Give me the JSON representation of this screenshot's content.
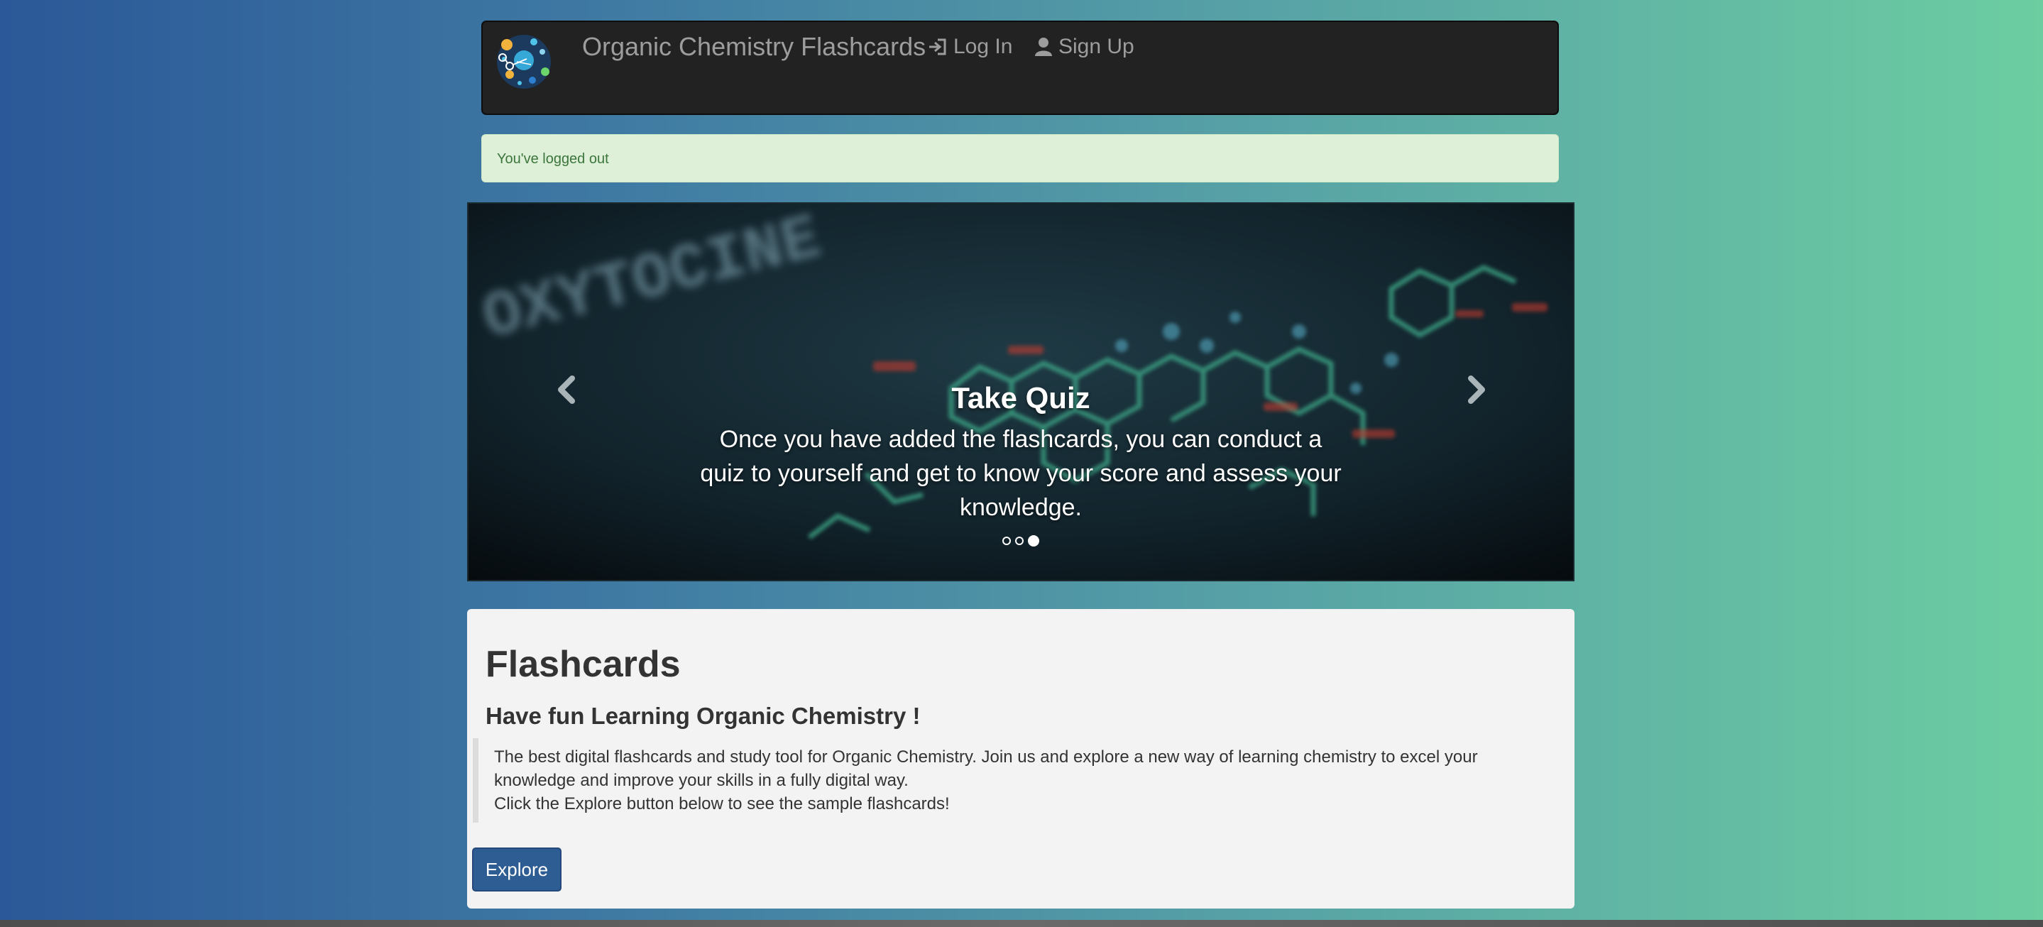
{
  "navbar": {
    "brand": "Organic Chemistry Flashcards",
    "login_label": "Log In",
    "signup_label": "Sign Up",
    "login_icon": "log-in-icon",
    "signup_icon": "user-icon"
  },
  "alert": {
    "message": "You've logged out"
  },
  "carousel": {
    "caption_title": "Take Quiz",
    "caption_text": "Once you have added the flashcards, you can conduct a quiz to yourself and get to know your score and assess your knowledge.",
    "background_text": "OXYTOCINE",
    "slide_count": 3,
    "active_slide": 3
  },
  "jumbotron": {
    "title": "Flashcards",
    "subtitle": "Have fun Learning Organic Chemistry !",
    "description": "The best digital flashcards and study tool for Organic Chemistry. Join us and explore a new way of learning chemistry to excel your knowledge and improve your skills in a fully digital way.",
    "hint": "Click the Explore button below to see the sample flashcards!",
    "explore_label": "Explore"
  },
  "colors": {
    "navbar_bg": "#222222",
    "alert_bg": "#dff0d8",
    "alert_text": "#3c763d",
    "button_bg": "#2e5d93",
    "jumbotron_bg": "#f3f3f3"
  }
}
